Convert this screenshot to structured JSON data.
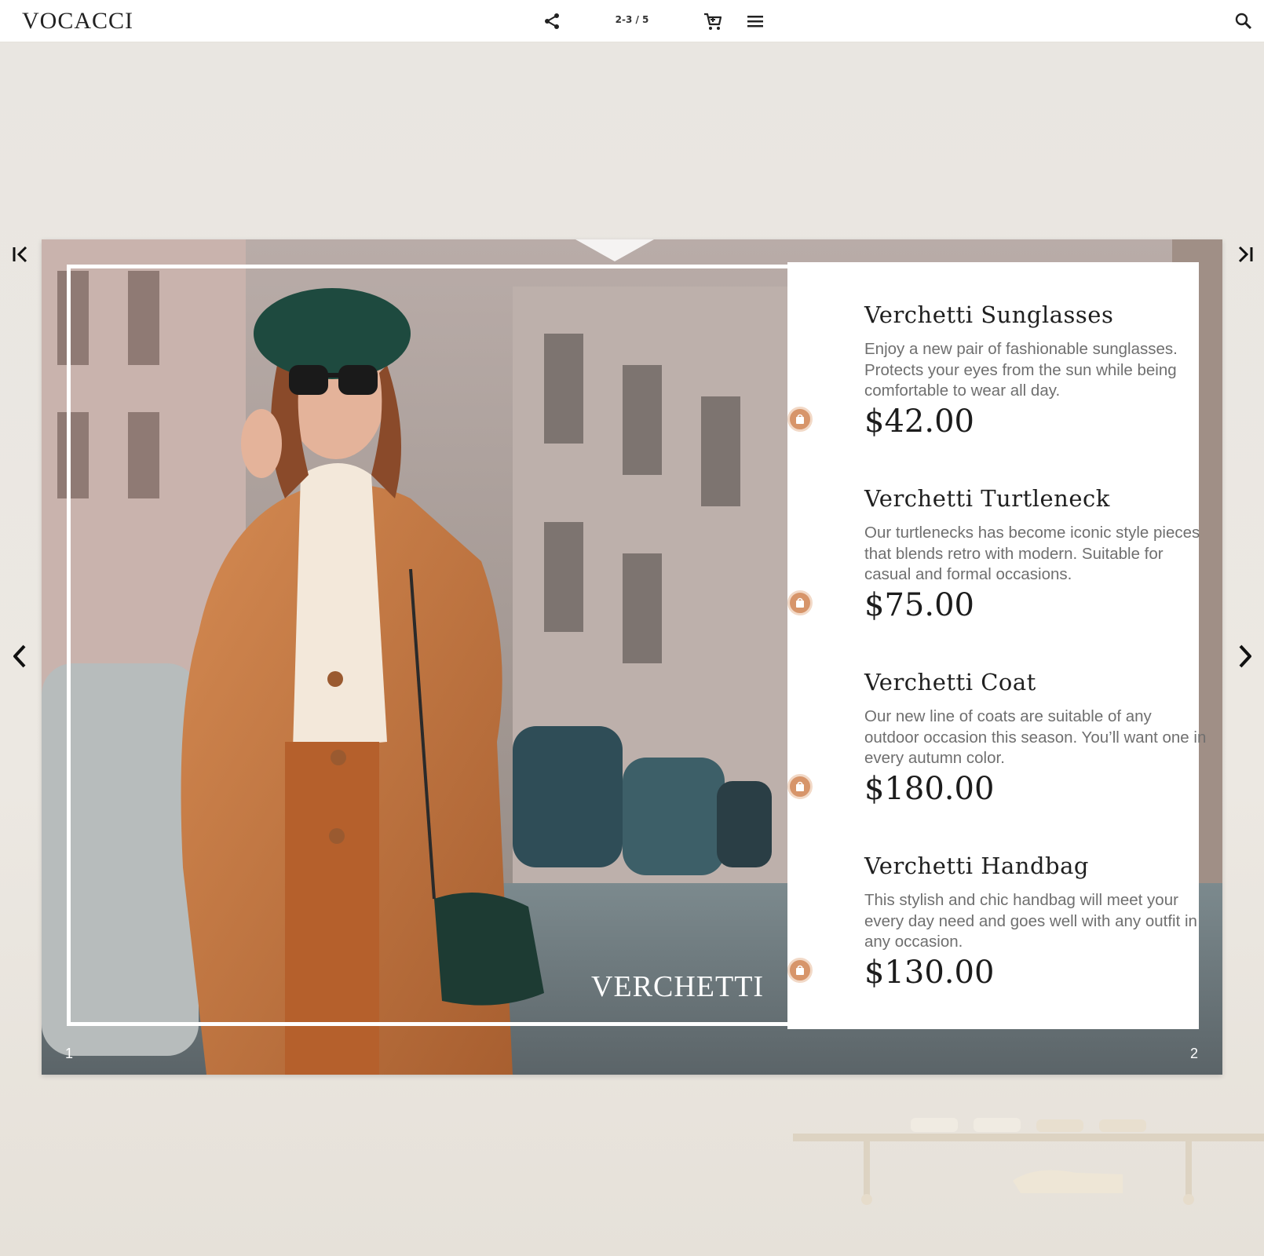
{
  "app": {
    "logo": "VOCACCI",
    "page_indicator": "2-3 / 5"
  },
  "toolbar": {
    "icons": [
      "share-icon",
      "cart-icon",
      "menu-icon",
      "search-icon"
    ]
  },
  "navigation": {
    "icons": [
      "first-page-icon",
      "last-page-icon",
      "prev-page-icon",
      "next-page-icon"
    ]
  },
  "spread": {
    "brand": "VERCHETTI",
    "left_page_number": "1",
    "right_page_number": "2"
  },
  "products": [
    {
      "name": "Verchetti Sunglasses",
      "description": "Enjoy a new pair of fashionable sunglasses. Protects your eyes from the sun while being comfortable to wear all day.",
      "price": "$42.00"
    },
    {
      "name": "Verchetti Turtleneck",
      "description": "Our turtlenecks has become iconic style pieces that blends retro with modern. Suitable for casual and formal occasions.",
      "price": "$75.00"
    },
    {
      "name": "Verchetti Coat",
      "description": "Our new line of coats are suitable of any outdoor occasion this season. You’ll want one in every autumn color.",
      "price": "$180.00"
    },
    {
      "name": "Verchetti Handbag",
      "description": "This stylish and chic handbag will meet your every day need and goes well with any outfit in any occasion.",
      "price": "$130.00"
    }
  ],
  "colors": {
    "accent_badge": "#d7956a",
    "coat": "#c47a45",
    "beret": "#1e4a3f"
  }
}
